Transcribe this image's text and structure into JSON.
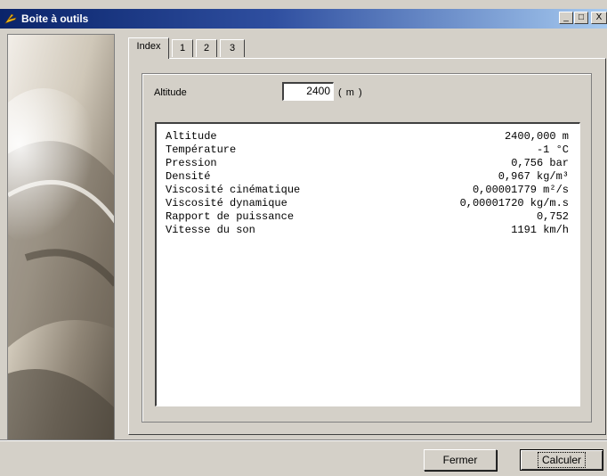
{
  "window": {
    "title": "Boite à outils",
    "min_label": "_",
    "max_label": "□",
    "close_label": "X"
  },
  "tabs": [
    {
      "label": "Index"
    },
    {
      "label": "1"
    },
    {
      "label": "2"
    },
    {
      "label": "3"
    }
  ],
  "altitude": {
    "label": "Altitude",
    "value": "2400",
    "unit": "( m )"
  },
  "results": [
    {
      "name": "Altitude",
      "value": "2400,000 m"
    },
    {
      "name": "Température",
      "value": "-1 °C"
    },
    {
      "name": "Pression",
      "value": "0,756 bar"
    },
    {
      "name": "Densité",
      "value": "0,967 kg/m³"
    },
    {
      "name": "Viscosité cinématique",
      "value": "0,00001779 m²/s"
    },
    {
      "name": "Viscosité dynamique",
      "value": "0,00001720 kg/m.s"
    },
    {
      "name": "Rapport de puissance",
      "value": "0,752"
    },
    {
      "name": "Vitesse du son",
      "value": "1191 km/h"
    }
  ],
  "buttons": {
    "close": "Fermer",
    "compute": "Calculer"
  }
}
